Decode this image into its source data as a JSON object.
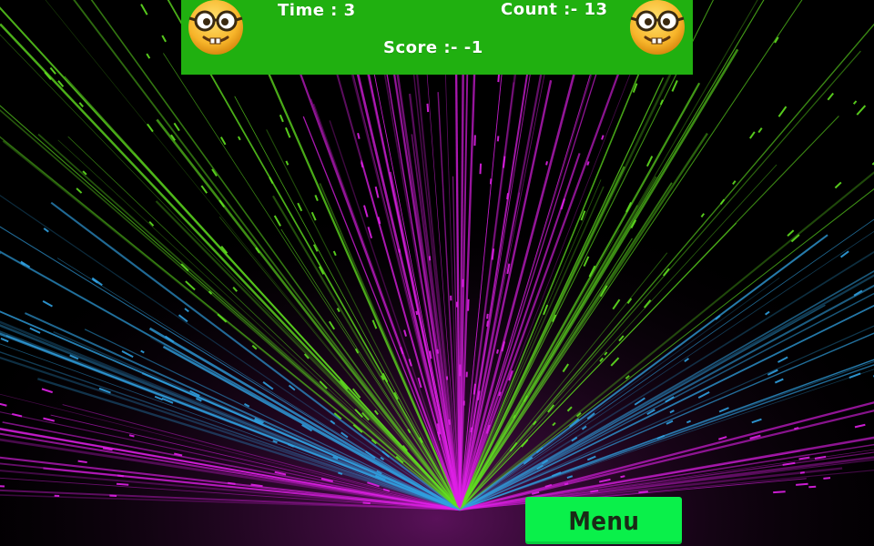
{
  "hud": {
    "time_label": "Time : 3",
    "count_label": "Count :- 13",
    "score_label": "Score :- -1",
    "background_color": "#20b010"
  },
  "icons": {
    "left": "nerd-face-emoji-icon",
    "right": "nerd-face-emoji-icon"
  },
  "menu": {
    "label": "Menu",
    "color": "#0af04a"
  },
  "background": {
    "colors": [
      "#e020e8",
      "#60e020",
      "#30a0e0"
    ]
  }
}
